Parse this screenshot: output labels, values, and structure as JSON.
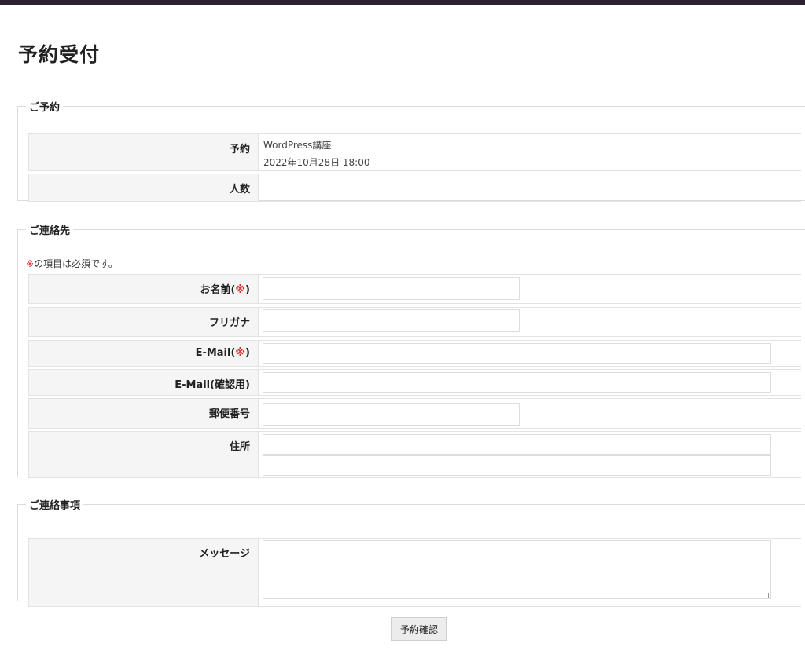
{
  "page": {
    "title": "予約受付"
  },
  "reservation": {
    "legend": "ご予約",
    "booking_label": "予約",
    "course": "WordPress講座",
    "datetime": "2022年10月28日 18:00",
    "people_label": "人数"
  },
  "contact": {
    "legend": "ご連絡先",
    "required_mark": "※",
    "required_note": "の項目は必須です。",
    "name_label": "お名前(",
    "name_label_end": ")",
    "furigana_label": "フリガナ",
    "email_label": "E-Mail(",
    "email_label_end": ")",
    "email_confirm_label": "E-Mail(確認用)",
    "postal_label": "郵便番号",
    "address_label": "住所",
    "name_value": "",
    "furigana_value": "",
    "email_value": "",
    "email_confirm_value": "",
    "postal_value": "",
    "address1_value": "",
    "address2_value": ""
  },
  "notes": {
    "legend": "ご連絡事項",
    "message_label": "メッセージ",
    "message_value": ""
  },
  "actions": {
    "confirm_label": "予約確認"
  },
  "colors": {
    "required": "#d0312d",
    "topbar": "#2b2430",
    "label_bg": "#f5f5f5"
  }
}
